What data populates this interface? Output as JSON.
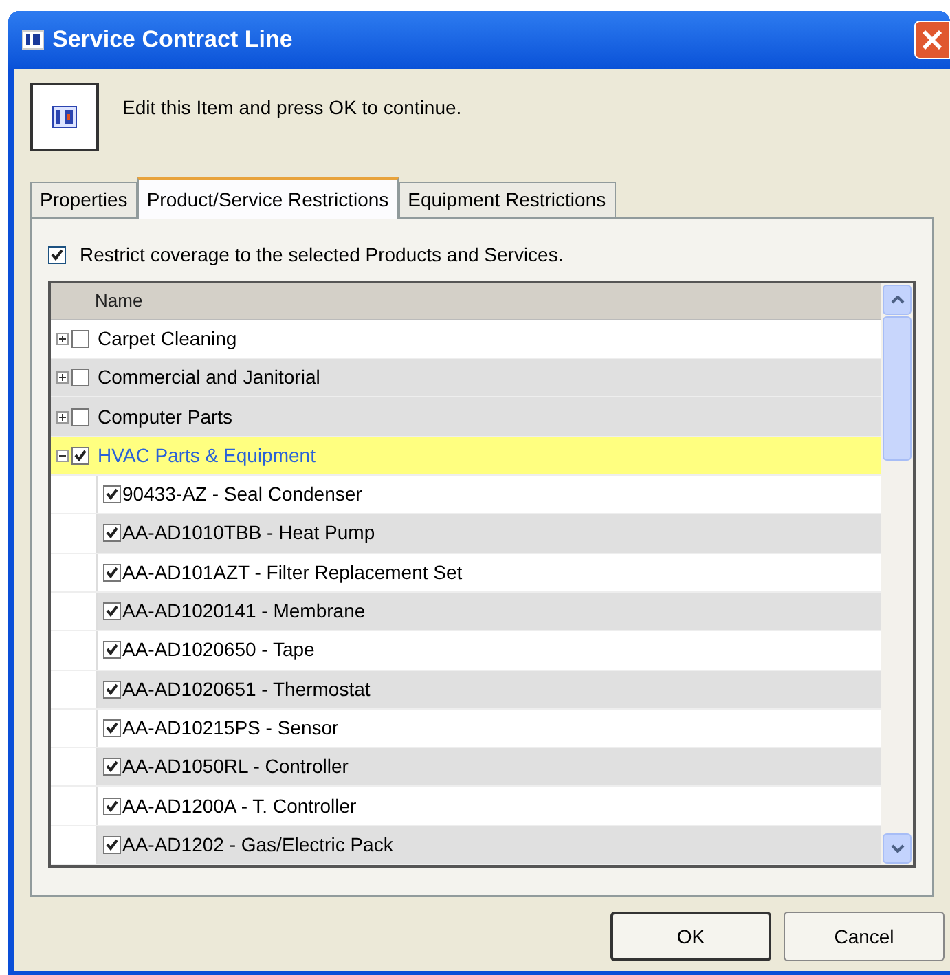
{
  "window": {
    "title": "Service Contract Line"
  },
  "instruction": "Edit this Item and press OK to continue.",
  "tabs": [
    {
      "label": "Properties",
      "selected": false
    },
    {
      "label": "Product/Service Restrictions",
      "selected": true
    },
    {
      "label": "Equipment Restrictions",
      "selected": false
    }
  ],
  "restrict": {
    "label": "Restrict coverage to the selected Products and Services.",
    "checked": true
  },
  "grid": {
    "columns": [
      "Name"
    ],
    "rows": [
      {
        "label": "Carpet Cleaning",
        "checked": false,
        "expanded": false,
        "selected": false,
        "shaded": false
      },
      {
        "label": "Commercial and Janitorial",
        "checked": false,
        "expanded": false,
        "selected": false,
        "shaded": true
      },
      {
        "label": "Computer Parts",
        "checked": false,
        "expanded": false,
        "selected": false,
        "shaded": true
      },
      {
        "label": "HVAC Parts & Equipment",
        "checked": true,
        "expanded": true,
        "selected": true,
        "children": [
          {
            "label": "90433-AZ - Seal Condenser",
            "checked": true,
            "selected": false,
            "shaded": false
          },
          {
            "label": "AA-AD1010TBB - Heat Pump",
            "checked": true,
            "selected": false,
            "shaded": true
          },
          {
            "label": "AA-AD101AZT - Filter Replacement Set",
            "checked": true,
            "selected": false,
            "shaded": false
          },
          {
            "label": "AA-AD1020141 - Membrane",
            "checked": true,
            "selected": false,
            "shaded": true
          },
          {
            "label": "AA-AD1020650 - Tape",
            "checked": true,
            "selected": false,
            "shaded": false
          },
          {
            "label": "AA-AD1020651 - Thermostat",
            "checked": true,
            "selected": false,
            "shaded": true
          },
          {
            "label": "AA-AD10215PS - Sensor",
            "checked": true,
            "selected": false,
            "shaded": false
          },
          {
            "label": "AA-AD1050RL - Controller",
            "checked": true,
            "selected": false,
            "shaded": true
          },
          {
            "label": "AA-AD1200A - T. Controller",
            "checked": true,
            "selected": false,
            "shaded": false
          },
          {
            "label": "AA-AD1202 - Gas/Electric Pack",
            "checked": true,
            "selected": false,
            "shaded": true
          }
        ]
      }
    ]
  },
  "buttons": [
    {
      "label": "OK",
      "default": true
    },
    {
      "label": "Cancel",
      "default": false
    }
  ]
}
